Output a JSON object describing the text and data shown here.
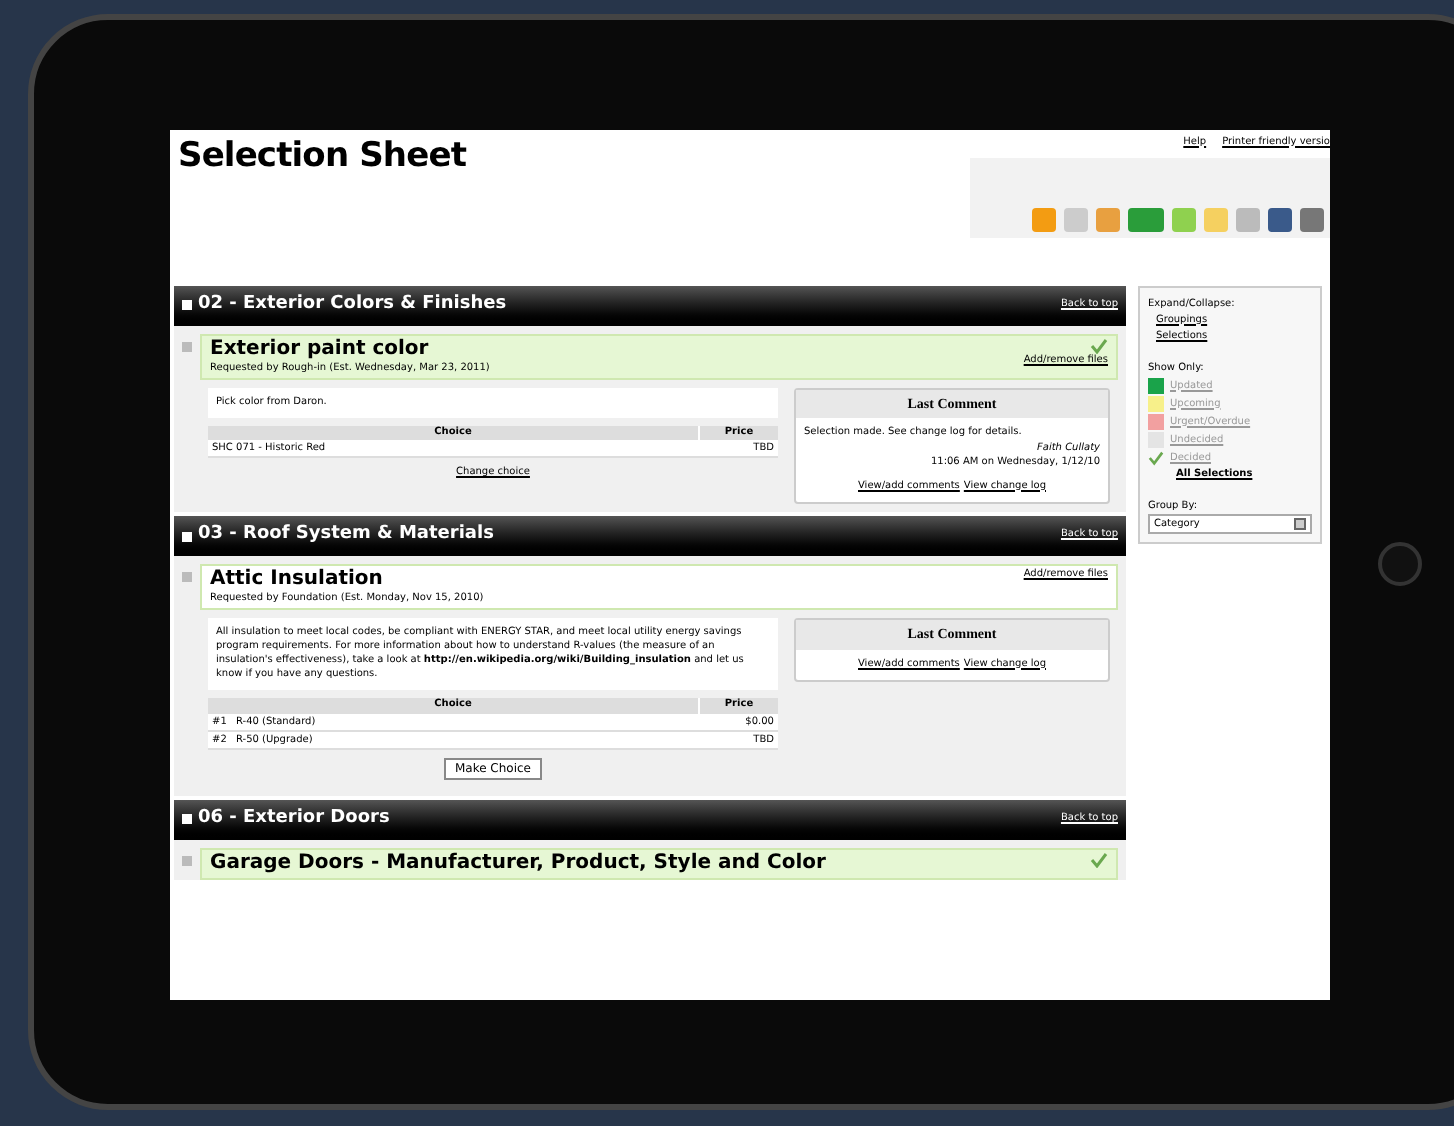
{
  "page_title": "Selection Sheet",
  "header_links": [
    {
      "label": "Help"
    },
    {
      "label": "Printer friendly versio"
    }
  ],
  "sections": [
    {
      "title": "02 - Exterior Colors & Finishes",
      "back_link": "Back to top",
      "items": [
        {
          "title": "Exterior paint color",
          "requested": "Requested by Rough-in (Est. Wednesday, Mar 23, 2011)",
          "decided": true,
          "add_link": "Add/remove files",
          "description": "Pick color from Daron.",
          "choice_header": "Choice",
          "price_header": "Price",
          "choices": [
            {
              "choice": "SHC 071 - Historic Red",
              "price": "TBD"
            }
          ],
          "action": {
            "kind": "link",
            "label": "Change choice"
          },
          "comment_heading": "Last Comment",
          "comment_text": "Selection made. See change log for details.",
          "comment_author": "Faith Cullaty",
          "comment_date": "11:06 AM on Wednesday, 1/12/10",
          "comment_links": [
            "View/add comments",
            "View change log"
          ]
        }
      ]
    },
    {
      "title": "03 - Roof System & Materials",
      "back_link": "Back to top",
      "items": [
        {
          "title": "Attic Insulation",
          "requested": "Requested by Foundation (Est. Monday, Nov 15, 2010)",
          "decided": false,
          "add_link": "Add/remove files",
          "description": "All insulation to meet local codes, be compliant with ENERGY STAR, and meet local utility energy savings program requirements. For more information about how to understand R-values (the measure of an insulation's effectiveness), take a look at **http://en.wikipedia.org/wiki/Building_insulation** and let us know if you have any questions.",
          "choice_header": "Choice",
          "price_header": "Price",
          "choices": [
            {
              "num": "#1",
              "choice": "R-40 (Standard)",
              "price": "$0.00"
            },
            {
              "num": "#2",
              "choice": "R-50 (Upgrade)",
              "price": "TBD"
            }
          ],
          "action": {
            "kind": "button",
            "label": "Make Choice"
          },
          "comment_heading": "Last Comment",
          "comment_links": [
            "View/add comments",
            "View change log"
          ]
        }
      ]
    },
    {
      "title": "06 - Exterior Doors",
      "back_link": "Back to top",
      "items": [
        {
          "title": "Garage Doors - Manufacturer, Product, Style and Color",
          "decided": true
        }
      ]
    }
  ],
  "sidebar": {
    "expand_label": "Expand/Collapse:",
    "expand_items": [
      "Groupings",
      "Selections"
    ],
    "show_label": "Show Only:",
    "filters": [
      {
        "label": "Updated",
        "kind": "swatch",
        "color": "#1aa34a"
      },
      {
        "label": "Upcoming",
        "kind": "swatch",
        "color": "#f7f08a"
      },
      {
        "label": "Urgent/Overdue",
        "kind": "swatch",
        "color": "#f2a0a0"
      },
      {
        "label": "Undecided",
        "kind": "swatch",
        "color": "#e4e4e4"
      },
      {
        "label": "Decided",
        "kind": "check"
      }
    ],
    "all_link": "All Selections",
    "group_label": "Group By:",
    "group_value": "Category"
  }
}
